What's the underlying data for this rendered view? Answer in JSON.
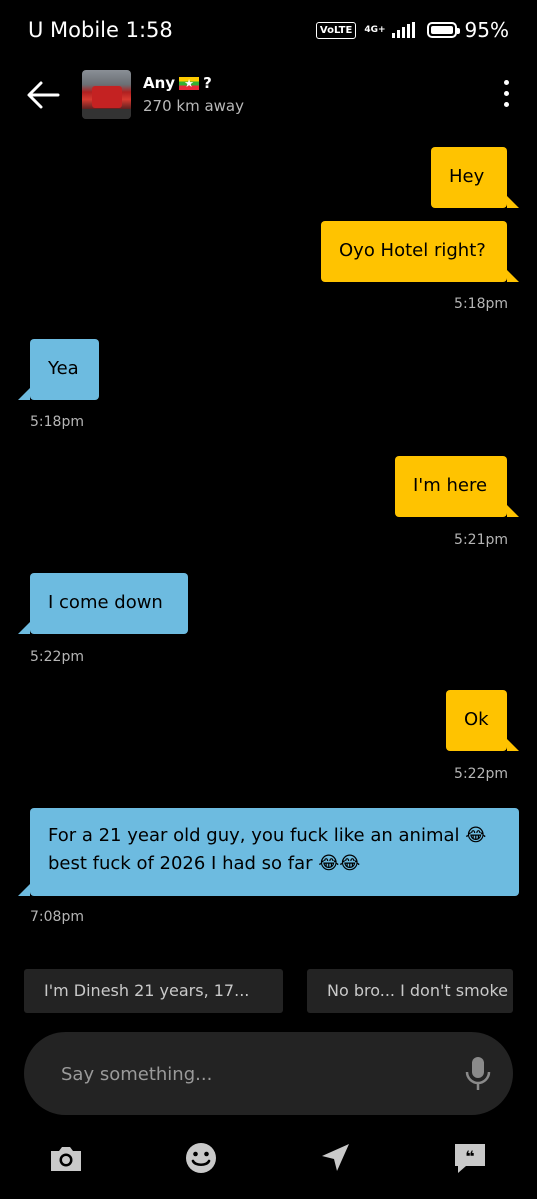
{
  "status": {
    "carrier": "U Mobile 1:58",
    "volte": "VoLTE",
    "network": "4G+",
    "battery": "95%"
  },
  "header": {
    "name": "Any",
    "flag_icon": "myanmar-flag-icon",
    "name_suffix": "?",
    "distance": "270 km away"
  },
  "messages": [
    {
      "dir": "out",
      "text": "Hey"
    },
    {
      "dir": "out",
      "text": "Oyo Hotel right?",
      "time": "5:18pm"
    },
    {
      "dir": "in",
      "text": "Yea",
      "time": "5:18pm"
    },
    {
      "dir": "out",
      "text": "I'm here",
      "time": "5:21pm"
    },
    {
      "dir": "in",
      "text": "I come down",
      "time": "5:22pm"
    },
    {
      "dir": "out",
      "text": "Ok",
      "time": "5:22pm"
    },
    {
      "dir": "in",
      "text": "For a 21 year old guy, you fuck like an animal 😂 best fuck of 2026 I had so far 😂😂",
      "time": "7:08pm"
    }
  ],
  "quick_replies": [
    "I'm Dinesh 21 years, 17...",
    "No bro... I don't smoke"
  ],
  "composer": {
    "placeholder": "Say something..."
  },
  "toolbar": [
    "camera-icon",
    "emoji-icon",
    "location-icon",
    "saved-phrases-icon"
  ],
  "colors": {
    "outgoing": "#ffc300",
    "incoming": "#6dbbe0",
    "background": "#000000"
  }
}
